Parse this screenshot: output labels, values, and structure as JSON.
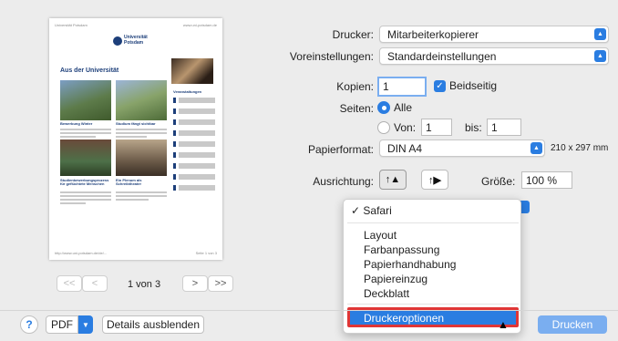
{
  "preview": {
    "header_left": "Universität Potsdam",
    "header_right": "www.uni-potsdam.de",
    "logo_text": "Universität Potsdam",
    "section_title": "Aus der Universität",
    "col1_top_caption": "Bewerbung Winter",
    "col2_top_caption": "Studium fängt sichtbar",
    "col1_bottom_caption": "Studienbewerbungsprozess für geflüchtete Menschen",
    "col2_bottom_caption": "Ein Plenum als Schreibtheater",
    "side_title": "Veranstaltungen",
    "footer_left": "http://www.uni-potsdam.de/de/...",
    "footer_right": "Seite 1 von 3",
    "page_label": "1 von 3",
    "first_label": "<<",
    "prev_label": "<",
    "next_label": ">",
    "last_label": ">>"
  },
  "settings": {
    "printer_label": "Drucker:",
    "printer_value": "Mitarbeiterkopierer",
    "presets_label": "Voreinstellungen:",
    "presets_value": "Standardeinstellungen",
    "copies_label": "Kopien:",
    "copies_value": "1",
    "duplex_label": "Beidseitig",
    "pages_label": "Seiten:",
    "pages_all": "Alle",
    "pages_from": "Von:",
    "from_value": "1",
    "to_label": "bis:",
    "to_value": "1",
    "paper_label": "Papierformat:",
    "paper_value": "DIN A4",
    "paper_size": "210 x 297 mm",
    "orientation_label": "Ausrichtung:",
    "scale_label": "Größe:",
    "scale_value": "100 %"
  },
  "menu": {
    "checked_item": "Safari",
    "items": [
      "Layout",
      "Farbanpassung",
      "Papierhandhabung",
      "Papiereinzug",
      "Deckblatt"
    ],
    "highlighted_item": "Druckeroptionen"
  },
  "footer": {
    "help": "?",
    "pdf_label": "PDF",
    "details_label": "Details ausblenden",
    "print_label": "Drucken"
  },
  "colors": {
    "accent": "#2a7de1",
    "highlight_border": "#e03636",
    "page_bg": "#ececec"
  },
  "icons": [
    "help-icon",
    "chevron-down-icon",
    "checkmark-icon",
    "portrait-icon",
    "landscape-icon",
    "pointer-cursor-icon"
  ]
}
